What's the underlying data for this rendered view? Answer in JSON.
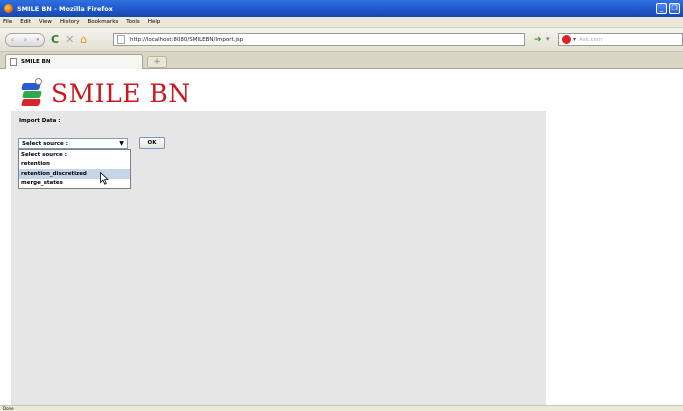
{
  "window": {
    "title": "SMILE BN - Mozilla Firefox"
  },
  "menu": [
    "File",
    "Edit",
    "View",
    "History",
    "Bookmarks",
    "Tools",
    "Help"
  ],
  "nav": {
    "url": "http://localhost:8080/SMILEBN/Import.jsp",
    "search_placeholder": "Ask.com"
  },
  "tab": {
    "label": "SMILE BN",
    "new_tab": "+"
  },
  "page": {
    "logo_text": "SMILE BN",
    "import_label": "Import Data :",
    "select_value": "Select source :",
    "ok_label": "OK",
    "options": [
      "Select source :",
      "retention",
      "retention_discretized",
      "merge_states"
    ],
    "highlighted_option": 2
  },
  "status": {
    "text": "Done"
  },
  "colors": {
    "logo_red": "#c8191f",
    "titlebar_blue": "#1d56c9",
    "panel_bg": "#e6e6e6",
    "selected_bg": "#c5d5ea"
  }
}
